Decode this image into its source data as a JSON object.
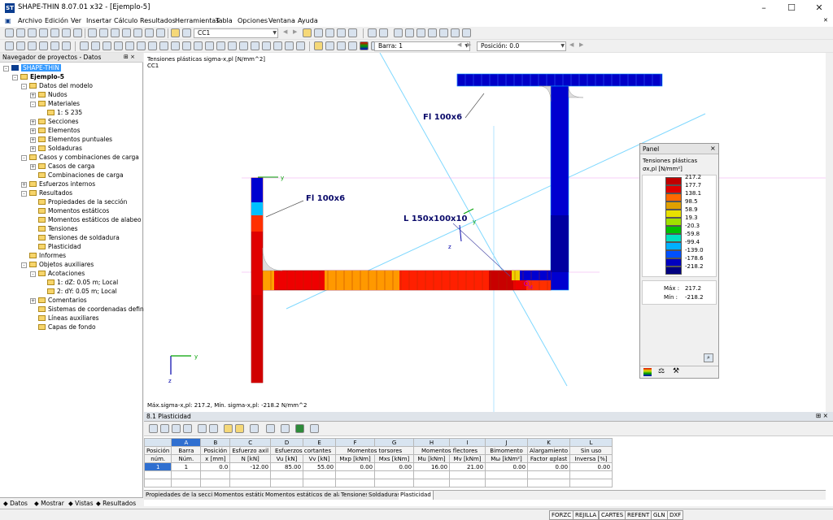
{
  "app": {
    "title": "SHAPE-THIN 8.07.01 x32 - [Ejemplo-5]",
    "icon_label": "ST"
  },
  "window_controls": {
    "minimize": "–",
    "maximize": "☐",
    "close": "✕"
  },
  "menu": [
    "Archivo",
    "Edición",
    "Ver",
    "Insertar",
    "Cálculo",
    "Resultados",
    "Herramientas",
    "Tabla",
    "Opciones",
    "Ventana",
    "Ayuda"
  ],
  "toolbar": {
    "load_case": "CC1",
    "bar_combo": "Barra: 1",
    "position_combo": "Posición: 0.0"
  },
  "navigator": {
    "title": "Navegador de proyectos - Datos",
    "pin": "⊞ ×",
    "items": [
      {
        "label": "SHAPE-THIN",
        "level": 0,
        "expander": "-",
        "selected": true
      },
      {
        "label": "Ejemplo-5",
        "level": 1,
        "expander": "-"
      },
      {
        "label": "Datos del modelo",
        "level": 2,
        "expander": "-"
      },
      {
        "label": "Nudos",
        "level": 3,
        "expander": "+"
      },
      {
        "label": "Materiales",
        "level": 3,
        "expander": "-"
      },
      {
        "label": "1: S 235",
        "level": 4,
        "expander": ""
      },
      {
        "label": "Secciones",
        "level": 3,
        "expander": "+"
      },
      {
        "label": "Elementos",
        "level": 3,
        "expander": "+"
      },
      {
        "label": "Elementos puntuales",
        "level": 3,
        "expander": "+"
      },
      {
        "label": "Soldaduras",
        "level": 3,
        "expander": "+"
      },
      {
        "label": "Casos y combinaciones de carga",
        "level": 2,
        "expander": "-"
      },
      {
        "label": "Casos de carga",
        "level": 3,
        "expander": "+"
      },
      {
        "label": "Combinaciones de carga",
        "level": 3,
        "expander": ""
      },
      {
        "label": "Esfuerzos internos",
        "level": 2,
        "expander": "+"
      },
      {
        "label": "Resultados",
        "level": 2,
        "expander": "-"
      },
      {
        "label": "Propiedades de la sección",
        "level": 3,
        "expander": ""
      },
      {
        "label": "Momentos estáticos",
        "level": 3,
        "expander": ""
      },
      {
        "label": "Momentos estáticos de alabeo",
        "level": 3,
        "expander": ""
      },
      {
        "label": "Tensiones",
        "level": 3,
        "expander": ""
      },
      {
        "label": "Tensiones de soldadura",
        "level": 3,
        "expander": ""
      },
      {
        "label": "Plasticidad",
        "level": 3,
        "expander": ""
      },
      {
        "label": "Informes",
        "level": 2,
        "expander": ""
      },
      {
        "label": "Objetos auxiliares",
        "level": 2,
        "expander": "-"
      },
      {
        "label": "Acotaciones",
        "level": 3,
        "expander": "-"
      },
      {
        "label": "1: dZ: 0.05 m; Local",
        "level": 4,
        "expander": ""
      },
      {
        "label": "2: dY: 0.05 m; Local",
        "level": 4,
        "expander": ""
      },
      {
        "label": "Comentarios",
        "level": 3,
        "expander": "+"
      },
      {
        "label": "Sistemas de coordenadas definidos p",
        "level": 3,
        "expander": ""
      },
      {
        "label": "Líneas auxiliares",
        "level": 3,
        "expander": ""
      },
      {
        "label": "Capas de fondo",
        "level": 3,
        "expander": ""
      }
    ],
    "tabs": [
      "Datos",
      "Mostrar",
      "Vistas",
      "Resultados"
    ]
  },
  "canvas": {
    "title_line1": "Tensiones plásticas sigma-x,pl [N/mm^2]",
    "title_line2": "CC1",
    "footer": "Máx.sigma-x,pl: 217.2, Mín. sigma-x,pl: -218.2 N/mm^2",
    "labels": {
      "fl_top": "Fl 100x6",
      "fl_left": "Fl 100x6",
      "l_angle": "L 150x100x10"
    },
    "axis_y": "y",
    "axis_z": "z",
    "node_m": "M"
  },
  "panel": {
    "title": "Panel",
    "close": "×",
    "heading": "Tensiones plásticas",
    "unit": "σx,pl [N/mm²]",
    "legend": [
      {
        "value": "217.2",
        "color": "#c00000"
      },
      {
        "value": "177.7",
        "color": "#e00000"
      },
      {
        "value": "138.1",
        "color": "#ff6a00"
      },
      {
        "value": "98.5",
        "color": "#e0a000"
      },
      {
        "value": "58.9",
        "color": "#e8e000"
      },
      {
        "value": "19.3",
        "color": "#a0e000"
      },
      {
        "value": "-20.3",
        "color": "#00c000"
      },
      {
        "value": "-59.8",
        "color": "#00e0c0"
      },
      {
        "value": "-99.4",
        "color": "#00b0ff"
      },
      {
        "value": "-139.0",
        "color": "#0050ff"
      },
      {
        "value": "-178.6",
        "color": "#0000c0"
      },
      {
        "value": "-218.2",
        "color": "#000080"
      }
    ],
    "max_label": "Máx :",
    "max_value": "217.2",
    "min_label": "Mín :",
    "min_value": "-218.2"
  },
  "table": {
    "title": "8.1 Plasticidad",
    "columns": [
      "A",
      "B",
      "C",
      "D",
      "E",
      "F",
      "G",
      "H",
      "I",
      "J",
      "K",
      "L"
    ],
    "header_row1": [
      "Posición",
      "Barra",
      "Posición",
      "Esfuerzo axil",
      "Esfuerzos cortantes",
      "",
      "Momentos torsores",
      "",
      "Momentos flectores",
      "",
      "Bimomento",
      "Alargamiento",
      "Sin uso"
    ],
    "header_row2": [
      "núm.",
      "Núm.",
      "x [mm]",
      "N [kN]",
      "Vu [kN]",
      "Vv [kN]",
      "Mxp [kNm]",
      "Mxs [kNm]",
      "Mu [kNm]",
      "Mv [kNm]",
      "Mω [kNm²]",
      "Factor αplast",
      "Inversa [%]"
    ],
    "rows": [
      [
        "1",
        "1",
        "0.0",
        "-12.00",
        "85.00",
        "55.00",
        "0.00",
        "0.00",
        "16.00",
        "21.00",
        "0.00",
        "0.00",
        "0.00"
      ]
    ],
    "sheet_tabs": [
      "Propiedades de la sección",
      "Momentos estáticos",
      "Momentos estáticos de alabeo",
      "Tensiones",
      "Soldaduras",
      "Plasticidad"
    ]
  },
  "statusbar": [
    "FORZC",
    "REJILLA",
    "CARTES",
    "REFENT",
    "GLN",
    "DXF"
  ]
}
